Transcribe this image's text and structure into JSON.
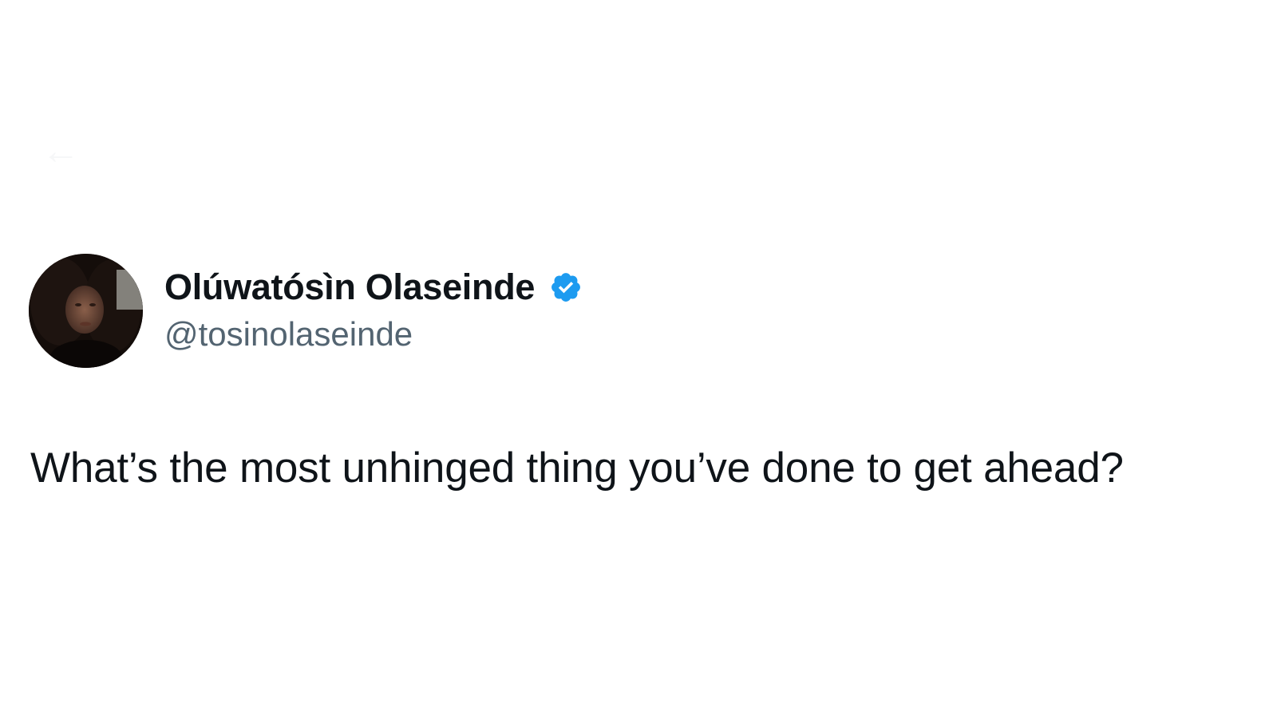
{
  "tweet": {
    "display_name": "Olúwatósìn Olaseinde",
    "handle": "@tosinolaseinde",
    "verified": true,
    "text": "What’s the most unhinged thing you’ve done to get ahead?"
  },
  "icons": {
    "back": "arrow-left-icon",
    "verified": "verified-badge-icon"
  },
  "colors": {
    "verified_blue": "#1d9bf0",
    "text_primary": "#0f1419",
    "text_secondary": "#536471"
  }
}
